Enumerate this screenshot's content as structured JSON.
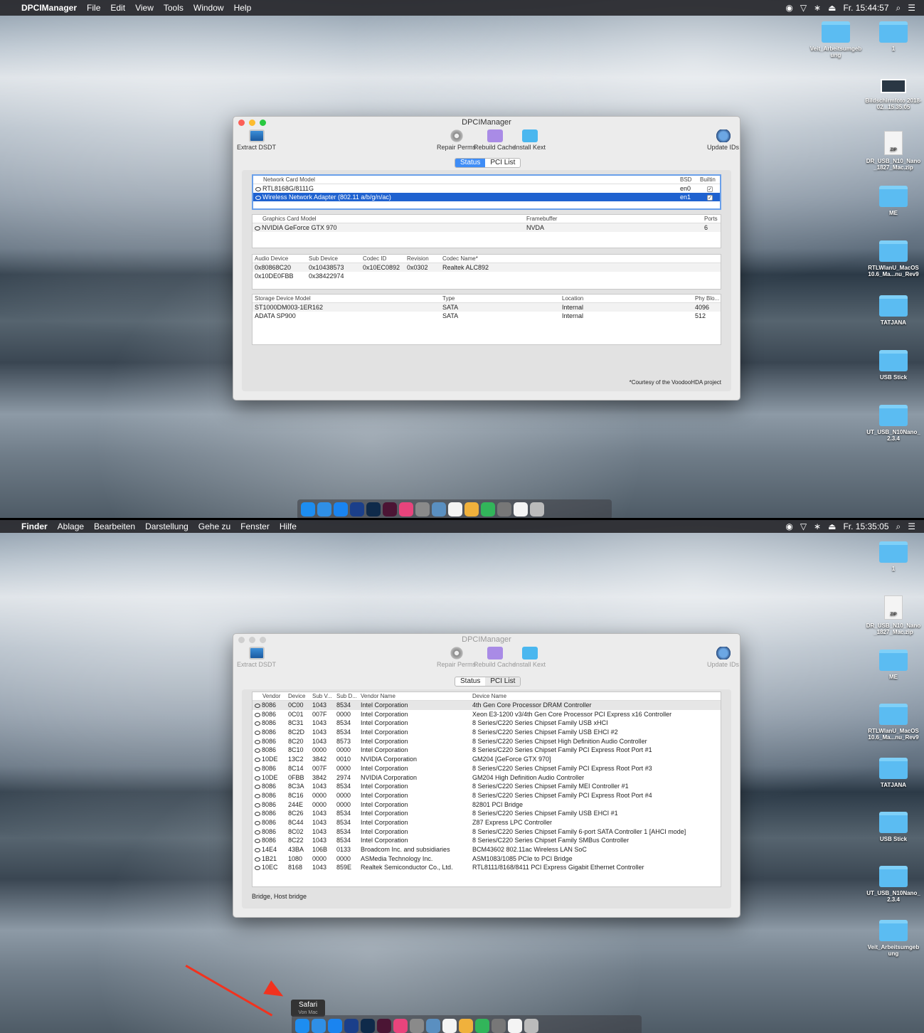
{
  "top": {
    "menubar": {
      "app": "DPCIManager",
      "items": [
        "File",
        "Edit",
        "View",
        "Tools",
        "Window",
        "Help"
      ],
      "clock": "Fr. 15:44:57"
    },
    "window": {
      "title": "DPCIManager",
      "toolbar": {
        "extract": "Extract DSDT",
        "repair": "Repair Perms",
        "rebuild": "Rebuild Cache",
        "install": "Install Kext",
        "update": "Update IDs"
      },
      "tabs": {
        "status": "Status",
        "pci": "PCI List"
      },
      "network": {
        "headers": [
          "Network Card Model",
          "BSD",
          "Builtin"
        ],
        "rows": [
          [
            "RTL8168G/8111G",
            "en0",
            "✓"
          ],
          [
            "Wireless Network Adapter (802.11 a/b/g/n/ac)",
            "en1",
            "✓"
          ]
        ]
      },
      "graphics": {
        "headers": [
          "Graphics Card Model",
          "Framebuffer",
          "Ports"
        ],
        "rows": [
          [
            "NVIDIA GeForce GTX 970",
            "NVDA",
            "6"
          ]
        ]
      },
      "audio": {
        "headers": [
          "Audio Device",
          "Sub Device",
          "Codec ID",
          "Revision",
          "Codec Name*"
        ],
        "rows": [
          [
            "0x80868C20",
            "0x10438573",
            "0x10EC0892",
            "0x0302",
            "Realtek ALC892"
          ],
          [
            "0x10DE0FBB",
            "0x38422974",
            "",
            "",
            ""
          ]
        ]
      },
      "storage": {
        "headers": [
          "Storage Device Model",
          "Type",
          "Location",
          "Phy Blo..."
        ],
        "rows": [
          [
            "ST1000DM003-1ER162",
            "SATA",
            "Internal",
            "4096"
          ],
          [
            "ADATA SP900",
            "SATA",
            "Internal",
            "512"
          ]
        ]
      },
      "footer": "*Courtesy of the VoodooHDA project"
    },
    "desktop": [
      {
        "label": "Veit_Arbeitsumgeb ung",
        "kind": "folder"
      },
      {
        "label": "1",
        "kind": "folder"
      },
      {
        "label": "Bildschirmfoto 2018-02...15.35.05",
        "kind": "shot"
      },
      {
        "label": "DR_USB_N10_Nano _1827_Mac.zip",
        "kind": "zip"
      },
      {
        "label": "ME",
        "kind": "folder"
      },
      {
        "label": "RTLWlanU_MacOS 10.6_Ma...nu_Rev9",
        "kind": "folder"
      },
      {
        "label": "TATJANA",
        "kind": "folder"
      },
      {
        "label": "USB Stick",
        "kind": "folder"
      },
      {
        "label": "UT_USB_N10Nano_ 2.3.4",
        "kind": "folder"
      }
    ]
  },
  "bottom": {
    "menubar": {
      "app": "Finder",
      "items": [
        "Ablage",
        "Bearbeiten",
        "Darstellung",
        "Gehe zu",
        "Fenster",
        "Hilfe"
      ],
      "clock": "Fr. 15:35:05"
    },
    "window": {
      "title": "DPCIManager",
      "pci": {
        "headers": [
          "Vendor",
          "Device",
          "Sub V...",
          "Sub D...",
          "Vendor Name",
          "Device Name"
        ],
        "rows": [
          [
            "8086",
            "0C00",
            "1043",
            "8534",
            "Intel Corporation",
            "4th Gen Core Processor DRAM Controller"
          ],
          [
            "8086",
            "0C01",
            "007F",
            "0000",
            "Intel Corporation",
            "Xeon E3-1200 v3/4th Gen Core Processor PCI Express x16 Controller"
          ],
          [
            "8086",
            "8C31",
            "1043",
            "8534",
            "Intel Corporation",
            "8 Series/C220 Series Chipset Family USB xHCI"
          ],
          [
            "8086",
            "8C2D",
            "1043",
            "8534",
            "Intel Corporation",
            "8 Series/C220 Series Chipset Family USB EHCI #2"
          ],
          [
            "8086",
            "8C20",
            "1043",
            "8573",
            "Intel Corporation",
            "8 Series/C220 Series Chipset High Definition Audio Controller"
          ],
          [
            "8086",
            "8C10",
            "0000",
            "0000",
            "Intel Corporation",
            "8 Series/C220 Series Chipset Family PCI Express Root Port #1"
          ],
          [
            "10DE",
            "13C2",
            "3842",
            "0010",
            "NVIDIA Corporation",
            "GM204 [GeForce GTX 970]"
          ],
          [
            "8086",
            "8C14",
            "007F",
            "0000",
            "Intel Corporation",
            "8 Series/C220 Series Chipset Family PCI Express Root Port #3"
          ],
          [
            "10DE",
            "0FBB",
            "3842",
            "2974",
            "NVIDIA Corporation",
            "GM204 High Definition Audio Controller"
          ],
          [
            "8086",
            "8C3A",
            "1043",
            "8534",
            "Intel Corporation",
            "8 Series/C220 Series Chipset Family MEI Controller #1"
          ],
          [
            "8086",
            "8C16",
            "0000",
            "0000",
            "Intel Corporation",
            "8 Series/C220 Series Chipset Family PCI Express Root Port #4"
          ],
          [
            "8086",
            "244E",
            "0000",
            "0000",
            "Intel Corporation",
            "82801 PCI Bridge"
          ],
          [
            "8086",
            "8C26",
            "1043",
            "8534",
            "Intel Corporation",
            "8 Series/C220 Series Chipset Family USB EHCI #1"
          ],
          [
            "8086",
            "8C44",
            "1043",
            "8534",
            "Intel Corporation",
            "Z87 Express LPC Controller"
          ],
          [
            "8086",
            "8C02",
            "1043",
            "8534",
            "Intel Corporation",
            "8 Series/C220 Series Chipset Family 6-port SATA Controller 1 [AHCI mode]"
          ],
          [
            "8086",
            "8C22",
            "1043",
            "8534",
            "Intel Corporation",
            "8 Series/C220 Series Chipset Family SMBus Controller"
          ],
          [
            "14E4",
            "43BA",
            "106B",
            "0133",
            "Broadcom Inc. and subsidiaries",
            "BCM43602 802.11ac Wireless LAN SoC"
          ],
          [
            "1B21",
            "1080",
            "0000",
            "0000",
            "ASMedia Technology Inc.",
            "ASM1083/1085 PCIe to PCI Bridge"
          ],
          [
            "10EC",
            "8168",
            "1043",
            "859E",
            "Realtek Semiconductor Co., Ltd.",
            "RTL8111/8168/8411 PCI Express Gigabit Ethernet Controller"
          ]
        ]
      },
      "footer": "Bridge, Host bridge"
    },
    "desktop": [
      {
        "label": "1",
        "kind": "folder"
      },
      {
        "label": "DR_USB_N10_Nano _1827_Mac.zip",
        "kind": "zip"
      },
      {
        "label": "ME",
        "kind": "folder"
      },
      {
        "label": "RTLWlanU_MacOS 10.6_Ma...nu_Rev9",
        "kind": "folder"
      },
      {
        "label": "TATJANA",
        "kind": "folder"
      },
      {
        "label": "USB Stick",
        "kind": "folder"
      },
      {
        "label": "UT_USB_N10Nano_ 2.3.4",
        "kind": "folder"
      },
      {
        "label": "Veit_Arbeitsumgeb ung",
        "kind": "folder"
      }
    ],
    "tooltip": {
      "title": "Safari",
      "subtitle": "Von Mac"
    }
  },
  "dock_icons": [
    "safari-icon",
    "finder-icon",
    "app-store-icon",
    "cinema4d-icon",
    "photoshop-icon",
    "indesign-icon",
    "itunes-icon",
    "launchpad-icon",
    "preview-icon",
    "calendar-icon",
    "photos-icon",
    "messages-icon",
    "systemprefs-icon",
    "file-icon",
    "trash-icon"
  ],
  "colors": {
    "accent": "#3f8df6",
    "selection": "#1f62d0",
    "folder": "#5bbcf2",
    "arrow": "#f2321e"
  }
}
